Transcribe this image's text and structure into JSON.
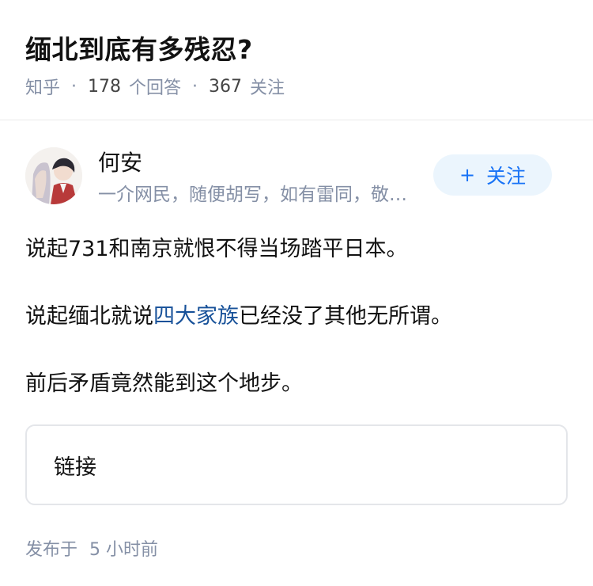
{
  "question": {
    "title": "缅北到底有多残忍?",
    "source": "知乎",
    "answer_count": "178",
    "answer_label": "个回答",
    "follower_count": "367",
    "follower_label": "关注"
  },
  "author": {
    "name": "何安",
    "bio": "一介网民，随便胡写，如有雷同，敬请谅解",
    "follow_label": "关注",
    "follow_icon": "plus-icon"
  },
  "answer": {
    "p1": "说起731和南京就恨不得当场踏平日本。",
    "p2_before": "说起缅北就说",
    "p2_link": "四大家族",
    "p2_after": "已经没了其他无所谓。",
    "p3": "前后矛盾竟然能到这个地步。",
    "link_card_label": "链接"
  },
  "footer": {
    "prefix": "发布于",
    "time_value": "5",
    "time_unit": "小时前"
  },
  "colors": {
    "accent": "#1772f6",
    "follow_bg": "#ebf5fd",
    "link": "#175199",
    "muted": "#8590a6"
  }
}
